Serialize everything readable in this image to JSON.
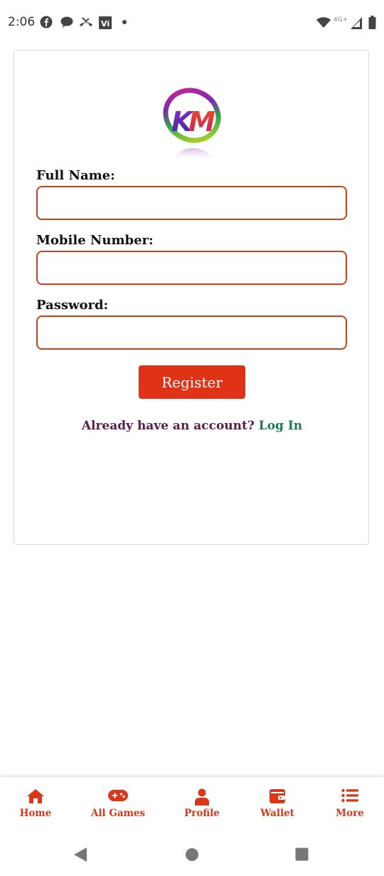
{
  "status_bar": {
    "time": "2:06",
    "left_icons": [
      "facebook-icon",
      "chat-bubble-icon",
      "missed-call-icon",
      "vi-app-icon",
      "dot-icon"
    ],
    "network_label": "4G+",
    "right_icons": [
      "wifi-icon",
      "signal-icon",
      "battery-icon"
    ]
  },
  "logo": {
    "text": "KM"
  },
  "form": {
    "full_name_label": "Full Name:",
    "full_name_value": "",
    "mobile_label": "Mobile Number:",
    "mobile_value": "",
    "password_label": "Password:",
    "password_value": "",
    "register_label": "Register",
    "login_question": "Already have an account?",
    "login_link": "Log In"
  },
  "bottom_nav": {
    "items": [
      {
        "label": "Home",
        "icon": "home-icon"
      },
      {
        "label": "All Games",
        "icon": "gamepad-icon"
      },
      {
        "label": "Profile",
        "icon": "user-icon"
      },
      {
        "label": "Wallet",
        "icon": "wallet-icon"
      },
      {
        "label": "More",
        "icon": "list-icon"
      }
    ]
  },
  "system_nav": {
    "icons": [
      "back-icon",
      "home-circle-icon",
      "recents-icon"
    ]
  },
  "colors": {
    "accent": "#df3216",
    "input_border": "#c94219",
    "nav_red": "#d9391a",
    "login_question": "#5a1a4a",
    "login_link": "#1f7a4d"
  }
}
